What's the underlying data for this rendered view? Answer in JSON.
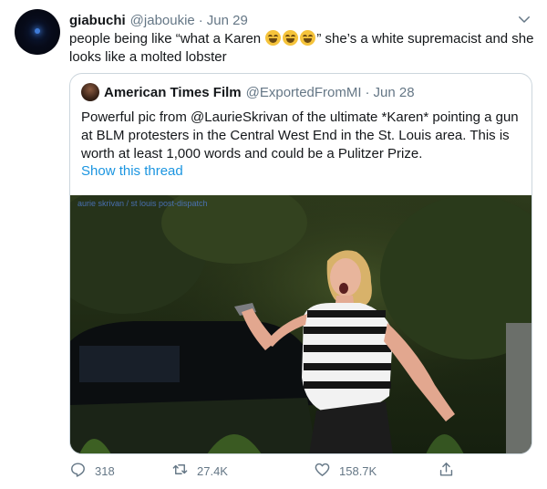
{
  "author": {
    "display_name": "giabuchi",
    "handle": "@jaboukie",
    "separator": "·",
    "date": "Jun 29"
  },
  "tweet": {
    "text_before": "people being like “what a Karen ",
    "emojis": [
      "joy-emoji",
      "joy-emoji",
      "joy-emoji"
    ],
    "text_after": "” she’s a white supremacist and she looks like a molted lobster"
  },
  "quoted": {
    "display_name": "American Times Film",
    "handle": "@ExportedFromMI",
    "separator": "·",
    "date": "Jun 28",
    "text": "Powerful pic from @LaurieSkrivan of the ultimate *Karen* pointing a gun at BLM protesters in the Central West End in the St. Louis area. This is worth at least 1,000 words and could be a Pulitzer Prize.",
    "show_thread": "Show this thread",
    "photo_credit": "aurie skrivan / st louis post-dispatch"
  },
  "stats": {
    "replies": "318",
    "retweets": "27.4K",
    "likes": "158.7K"
  },
  "icons": [
    "caret-down-icon",
    "reply-icon",
    "retweet-icon",
    "like-icon",
    "share-icon"
  ],
  "colors": {
    "link": "#1b95e0",
    "muted": "#657786",
    "border": "#ccd6dd",
    "text": "#14171a"
  }
}
